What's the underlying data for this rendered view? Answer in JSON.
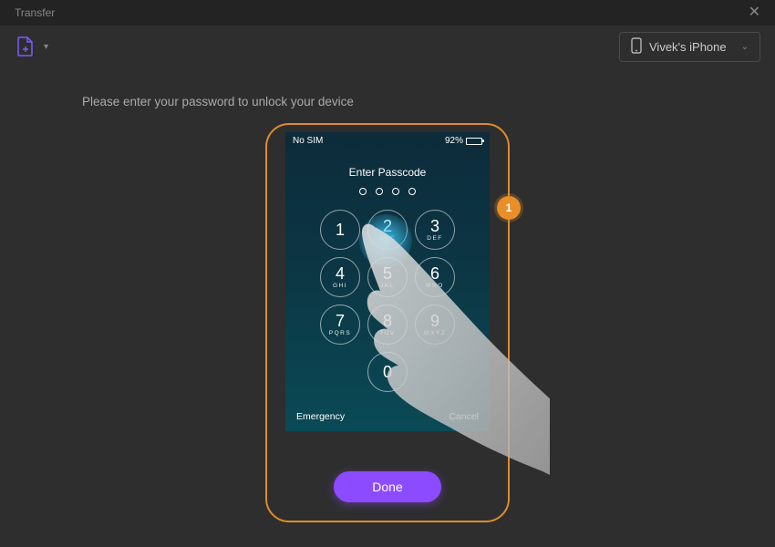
{
  "window": {
    "title": "Transfer"
  },
  "toolbar": {
    "device_selected": "Vivek's iPhone"
  },
  "main": {
    "instruction": "Please enter your password to unlock your device",
    "step_number": "1",
    "done_label": "Done"
  },
  "phone": {
    "status_sim": "No SIM",
    "status_battery": "92%",
    "passcode_title": "Enter Passcode",
    "keypad": [
      {
        "num": "1",
        "ltr": ""
      },
      {
        "num": "2",
        "ltr": "ABC"
      },
      {
        "num": "3",
        "ltr": "DEF"
      },
      {
        "num": "4",
        "ltr": "GHI"
      },
      {
        "num": "5",
        "ltr": "JKL"
      },
      {
        "num": "6",
        "ltr": "MNO"
      },
      {
        "num": "7",
        "ltr": "PQRS"
      },
      {
        "num": "8",
        "ltr": "TUV"
      },
      {
        "num": "9",
        "ltr": "WXYZ"
      },
      {
        "num": "0",
        "ltr": ""
      }
    ],
    "footer_left": "Emergency",
    "footer_right": "Cancel"
  }
}
